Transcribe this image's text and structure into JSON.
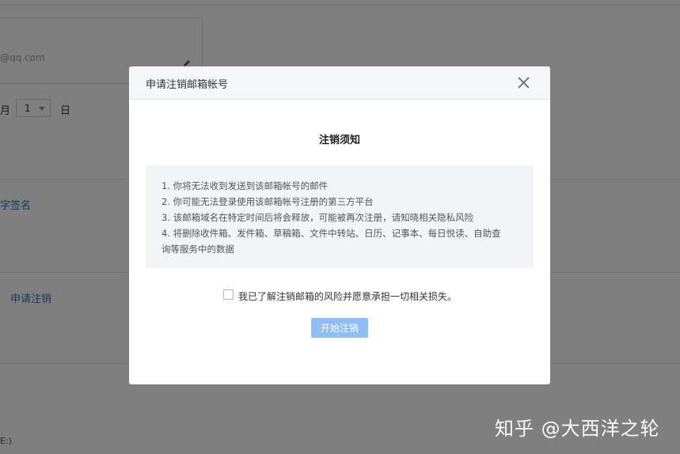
{
  "background_page": {
    "email_fragment": "@qq.com",
    "month_label": "月",
    "day_select_value": "1",
    "day_label": "日",
    "signature_link": "字签名",
    "deregister_link": "申请注销",
    "bottom_fragment": "E:)"
  },
  "modal": {
    "title": "申请注销邮箱帐号",
    "notice_heading": "注销须知",
    "notice_lines": [
      "1. 你将无法收到发送到该邮箱帐号的邮件",
      "2. 你可能无法登录使用该邮箱帐号注册的第三方平台",
      "3. 该邮箱域名在特定时间后将会释放，可能被再次注册，请知晓相关隐私风险",
      "4. 将删除收件箱、发件箱、草稿箱、文件中转站、日历、记事本、每日悦读、自助查",
      "询等服务中的数据"
    ],
    "agree_label": "我已了解注销邮箱的风险并愿意承担一切相关损失。",
    "agree_checked": false,
    "start_button_label": "开始注销",
    "start_button_color": "#8fbff2"
  },
  "watermark": "知乎 @大西洋之轮",
  "icons": {
    "close": "close-icon",
    "edit": "pencil-icon",
    "caret": "chevron-down-icon"
  }
}
